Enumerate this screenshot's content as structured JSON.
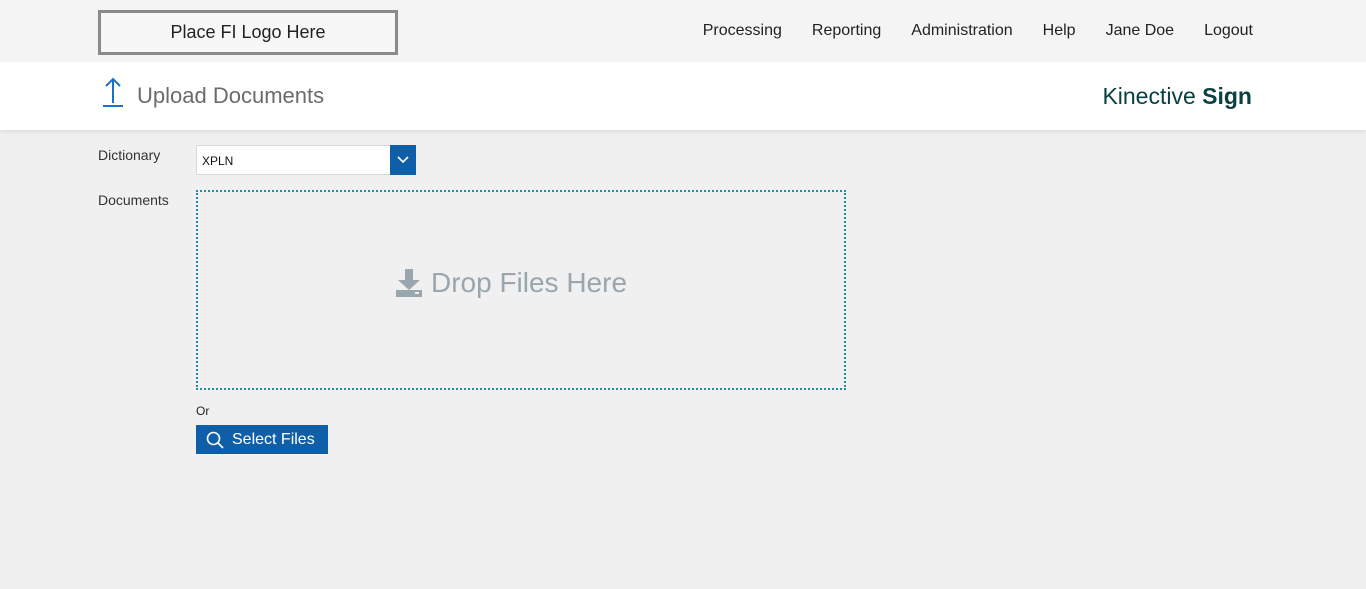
{
  "header": {
    "logo_placeholder": "Place FI Logo Here",
    "nav": [
      "Processing",
      "Reporting",
      "Administration",
      "Help",
      "Jane Doe",
      "Logout"
    ]
  },
  "subheader": {
    "title": "Upload Documents",
    "brand_regular": "Kinective",
    "brand_bold": "Sign",
    "icon": "upload-arrow-icon"
  },
  "form": {
    "dictionary_label": "Dictionary",
    "dictionary_value": "XPLN",
    "documents_label": "Documents",
    "drop_text": "Drop Files Here",
    "or_text": "Or",
    "select_files_label": "Select Files"
  },
  "colors": {
    "accent": "#0f5fa8",
    "dropzone_border": "#1e8f9c",
    "brand": "#0a4041"
  }
}
